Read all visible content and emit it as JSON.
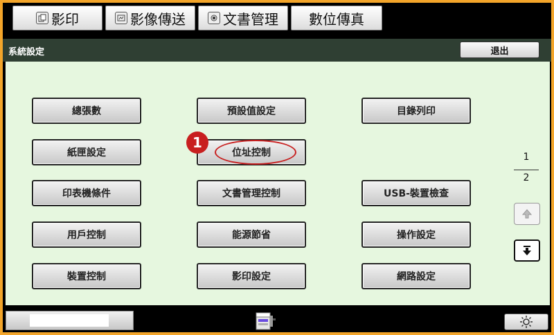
{
  "tabs": [
    {
      "label": "影印",
      "icon": "copy-icon"
    },
    {
      "label": "影像傳送",
      "icon": "image-send-icon"
    },
    {
      "label": "文書管理",
      "icon": "document-filing-icon"
    },
    {
      "label": "數位傳真",
      "icon": ""
    }
  ],
  "header": {
    "title": "系統設定",
    "exit_label": "退出"
  },
  "menu": {
    "col1": [
      "總張數",
      "紙匣設定",
      "印表機條件",
      "用戶控制",
      "裝置控制"
    ],
    "col2": [
      "預設值設定",
      "位址控制",
      "文書管理控制",
      "能源節省",
      "影印設定"
    ],
    "col3": [
      "目錄列印",
      "USB-裝置檢查",
      "操作設定",
      "網路設定"
    ]
  },
  "annotation": {
    "badge": "1",
    "highlighted_item": "位址控制",
    "color": "#c81f1f"
  },
  "pager": {
    "current": "1",
    "total": "2",
    "up_icon": "arrow-up-icon",
    "down_icon": "arrow-down-icon"
  },
  "footer": {
    "center_icon": "machine-status-icon",
    "brightness_icon": "sun-icon"
  },
  "colors": {
    "frame": "#f3a52a",
    "titlebar": "#2f3f33",
    "panel": "#e6f7df"
  }
}
